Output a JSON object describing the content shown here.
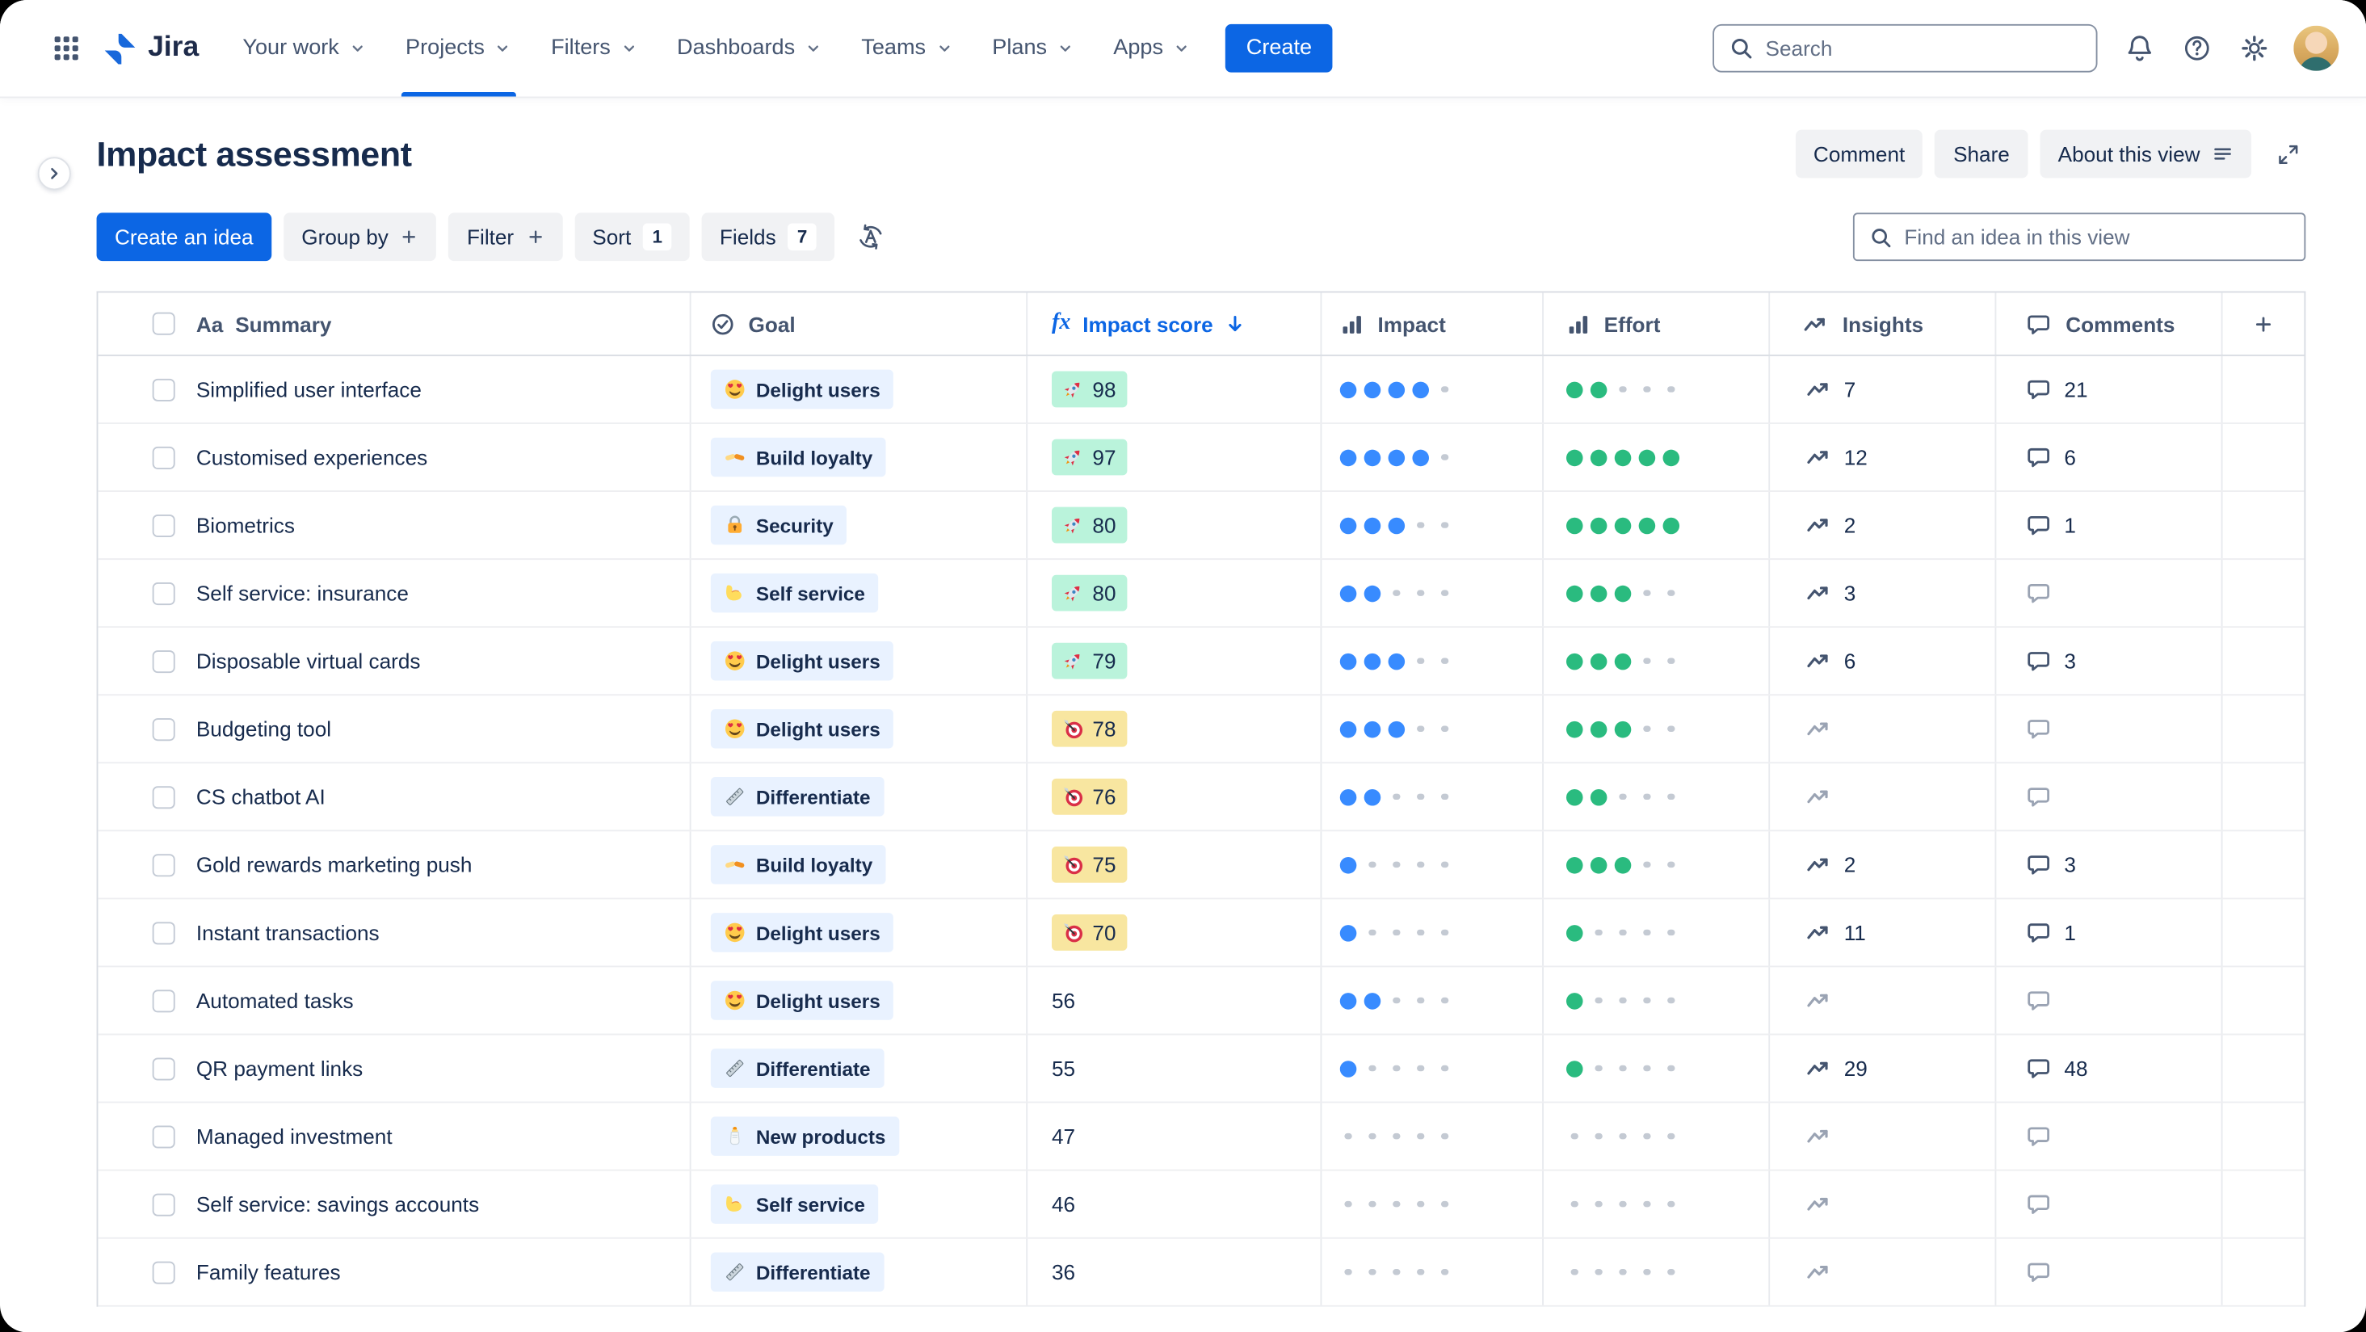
{
  "nav": {
    "logo": "Jira",
    "items": [
      {
        "label": "Your work"
      },
      {
        "label": "Projects",
        "active": true
      },
      {
        "label": "Filters"
      },
      {
        "label": "Dashboards"
      },
      {
        "label": "Teams"
      },
      {
        "label": "Plans"
      },
      {
        "label": "Apps"
      }
    ],
    "create": "Create",
    "search_placeholder": "Search"
  },
  "header": {
    "title": "Impact assessment",
    "comment": "Comment",
    "share": "Share",
    "about": "About this view"
  },
  "toolbar": {
    "create_idea": "Create an idea",
    "group_by": "Group by",
    "filter": "Filter",
    "sort": "Sort",
    "sort_count": "1",
    "fields": "Fields",
    "fields_count": "7",
    "find_placeholder": "Find an idea in this view"
  },
  "table": {
    "columns": {
      "summary_prefix": "Aa",
      "summary": "Summary",
      "goal": "Goal",
      "fx": "fx",
      "impact_score": "Impact score",
      "impact": "Impact",
      "effort": "Effort",
      "insights": "Insights",
      "comments": "Comments"
    },
    "rows": [
      {
        "summary": "Simplified user interface",
        "goal_emoji": "heart-eyes",
        "goal": "Delight users",
        "score": 98,
        "score_badge": "green",
        "score_emoji": "rocket",
        "impact": 4,
        "effort": 2,
        "insights": 7,
        "comments": 21
      },
      {
        "summary": "Customised experiences",
        "goal_emoji": "handshake",
        "goal": "Build loyalty",
        "score": 97,
        "score_badge": "green",
        "score_emoji": "rocket",
        "impact": 4,
        "effort": 5,
        "insights": 12,
        "comments": 6
      },
      {
        "summary": "Biometrics",
        "goal_emoji": "locked",
        "goal": "Security",
        "score": 80,
        "score_badge": "green",
        "score_emoji": "rocket",
        "impact": 3,
        "effort": 5,
        "insights": 2,
        "comments": 1
      },
      {
        "summary": "Self service: insurance",
        "goal_emoji": "biceps",
        "goal": "Self service",
        "score": 80,
        "score_badge": "green",
        "score_emoji": "rocket",
        "impact": 2,
        "effort": 3,
        "insights": 3,
        "comments": null
      },
      {
        "summary": "Disposable virtual cards",
        "goal_emoji": "heart-eyes",
        "goal": "Delight users",
        "score": 79,
        "score_badge": "green",
        "score_emoji": "rocket",
        "impact": 3,
        "effort": 3,
        "insights": 6,
        "comments": 3
      },
      {
        "summary": "Budgeting tool",
        "goal_emoji": "heart-eyes",
        "goal": "Delight users",
        "score": 78,
        "score_badge": "yellow",
        "score_emoji": "dart",
        "impact": 3,
        "effort": 3,
        "insights": null,
        "comments": null
      },
      {
        "summary": "CS chatbot AI",
        "goal_emoji": "ruler",
        "goal": "Differentiate",
        "score": 76,
        "score_badge": "yellow",
        "score_emoji": "dart",
        "impact": 2,
        "effort": 2,
        "insights": null,
        "comments": null
      },
      {
        "summary": "Gold rewards marketing push",
        "goal_emoji": "handshake",
        "goal": "Build loyalty",
        "score": 75,
        "score_badge": "yellow",
        "score_emoji": "dart",
        "impact": 1,
        "effort": 3,
        "insights": 2,
        "comments": 3
      },
      {
        "summary": "Instant transactions",
        "goal_emoji": "heart-eyes",
        "goal": "Delight users",
        "score": 70,
        "score_badge": "yellow",
        "score_emoji": "dart",
        "impact": 1,
        "effort": 1,
        "insights": 11,
        "comments": 1
      },
      {
        "summary": "Automated tasks",
        "goal_emoji": "heart-eyes",
        "goal": "Delight users",
        "score": 56,
        "score_badge": "none",
        "score_emoji": null,
        "impact": 2,
        "effort": 1,
        "insights": null,
        "comments": null
      },
      {
        "summary": "QR payment links",
        "goal_emoji": "ruler",
        "goal": "Differentiate",
        "score": 55,
        "score_badge": "none",
        "score_emoji": null,
        "impact": 1,
        "effort": 1,
        "insights": 29,
        "comments": 48
      },
      {
        "summary": "Managed investment",
        "goal_emoji": "baby-bottle",
        "goal": "New products",
        "score": 47,
        "score_badge": "none",
        "score_emoji": null,
        "impact": 0,
        "effort": 0,
        "insights": null,
        "comments": null
      },
      {
        "summary": "Self service: savings accounts",
        "goal_emoji": "biceps",
        "goal": "Self service",
        "score": 46,
        "score_badge": "none",
        "score_emoji": null,
        "impact": 0,
        "effort": 0,
        "insights": null,
        "comments": null
      },
      {
        "summary": "Family features",
        "goal_emoji": "ruler",
        "goal": "Differentiate",
        "score": 36,
        "score_badge": "none",
        "score_emoji": null,
        "impact": 0,
        "effort": 0,
        "insights": null,
        "comments": null
      }
    ]
  },
  "colors": {
    "accent_blue": "#0C66E4",
    "badge_green": "#BAF3DB",
    "badge_yellow": "#F8E6A0",
    "impact_dot": "#388BFF",
    "effort_dot": "#2ABB7F",
    "goal_pill": "#E9F2FF"
  }
}
